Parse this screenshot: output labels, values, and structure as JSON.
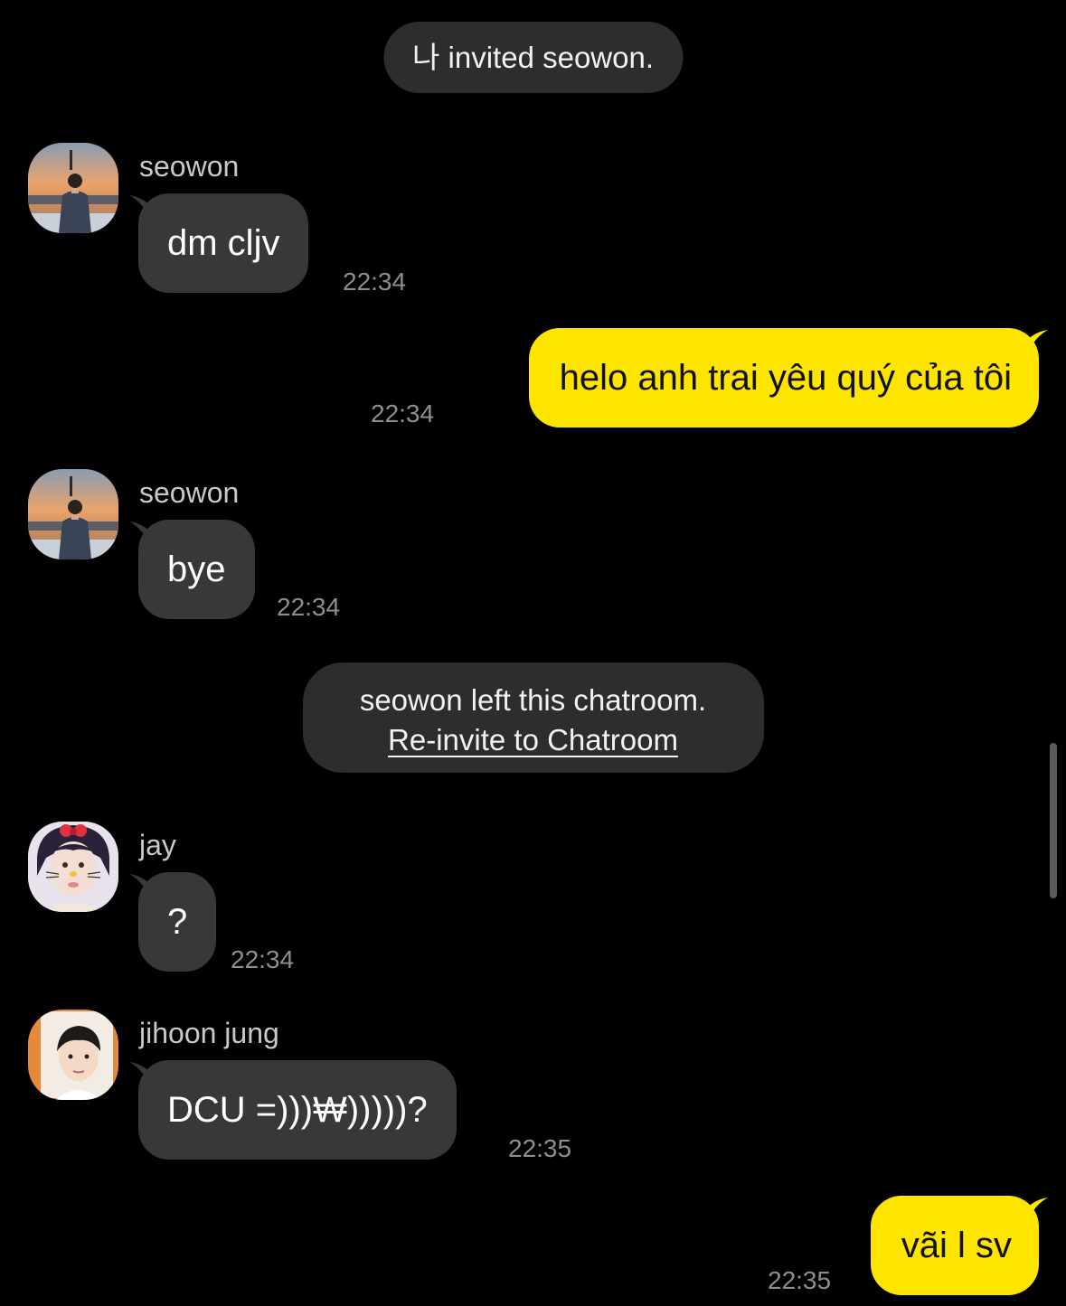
{
  "system_messages": {
    "invited": "나 invited seowon.",
    "left_text": "seowon left this chatroom.",
    "reinvite_link": "Re-invite to Chatroom"
  },
  "messages": [
    {
      "sender": "seowon",
      "text": "dm cljv",
      "time": "22:34",
      "direction": "incoming"
    },
    {
      "sender": "",
      "text": "helo anh trai yêu quý của tôi",
      "time": "22:34",
      "direction": "outgoing"
    },
    {
      "sender": "seowon",
      "text": "bye",
      "time": "22:34",
      "direction": "incoming"
    },
    {
      "sender": "jay",
      "text": "?",
      "time": "22:34",
      "direction": "incoming"
    },
    {
      "sender": "jihoon jung",
      "text": "DCU =)))₩)))))?",
      "time": "22:35",
      "direction": "incoming"
    },
    {
      "sender": "",
      "text": "vãi l sv",
      "time": "22:35",
      "direction": "outgoing"
    }
  ],
  "colors": {
    "background": "#000000",
    "incoming_bubble": "#383838",
    "outgoing_bubble": "#fee500",
    "system_pill": "#2d2d2d",
    "timestamp": "#8e8e8e"
  }
}
